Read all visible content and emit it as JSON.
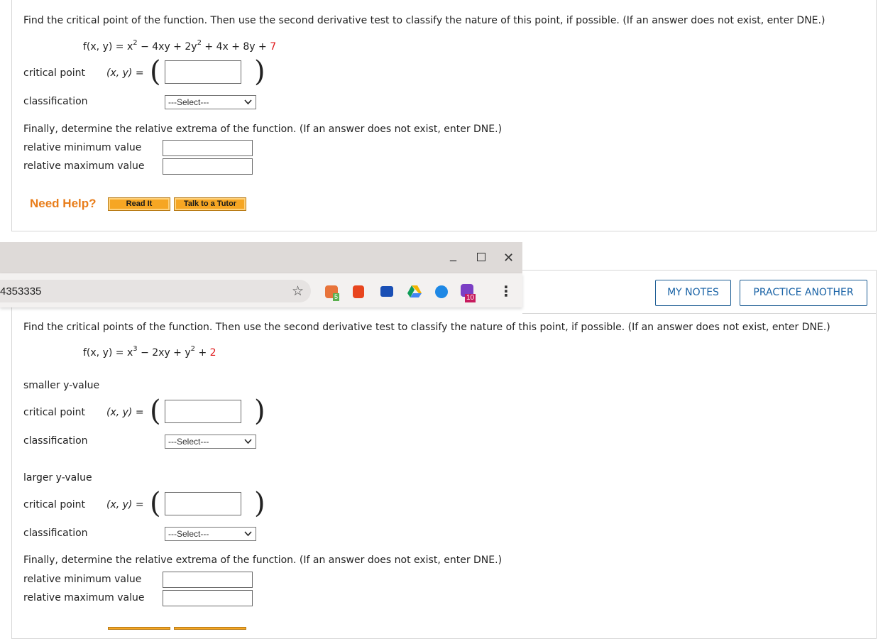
{
  "q1": {
    "instruction": "Find the critical point of the function. Then use the second derivative test to classify the nature of this point, if possible. (If an answer does not exist, enter DNE.)",
    "formula_lhs": "f(x, y) = x",
    "formula_mid1": " − 4xy + 2y",
    "formula_mid2": " + 4x + 8y + ",
    "formula_const": "7",
    "critical_point_label": "critical point",
    "xy_label": "(x, y) =",
    "classification_label": "classification",
    "select_value": "---Select---",
    "finally_text": "Finally, determine the relative extrema of the function. (If an answer does not exist, enter DNE.)",
    "rel_min_label": "relative minimum value",
    "rel_max_label": "relative maximum value",
    "need_help": "Need Help?",
    "read_it": "Read It",
    "talk_tutor": "Talk to a Tutor"
  },
  "browser": {
    "url_fragment": "4353335",
    "badge_count": "10",
    "small_badge": "5",
    "minimize": "_",
    "maximize": "☐",
    "close": "✕",
    "star": "☆",
    "menu": "⋮"
  },
  "header_buttons": {
    "my_notes": "MY NOTES",
    "practice_another": "PRACTICE ANOTHER"
  },
  "q2": {
    "instruction": "Find the critical points of the function. Then use the second derivative test to classify the nature of this point, if possible. (If an answer does not exist, enter DNE.)",
    "formula_lhs": "f(x, y) = x",
    "formula_mid1": " − 2xy + y",
    "formula_mid2": " + ",
    "formula_const": "2",
    "smaller_label": "smaller y-value",
    "larger_label": "larger y-value",
    "critical_point_label": "critical point",
    "xy_label": "(x, y) =",
    "classification_label": "classification",
    "select_value": "---Select---",
    "finally_text": "Finally, determine the relative extrema of the function. (If an answer does not exist, enter DNE.)",
    "rel_min_label": "relative minimum value",
    "rel_max_label": "relative maximum value"
  }
}
